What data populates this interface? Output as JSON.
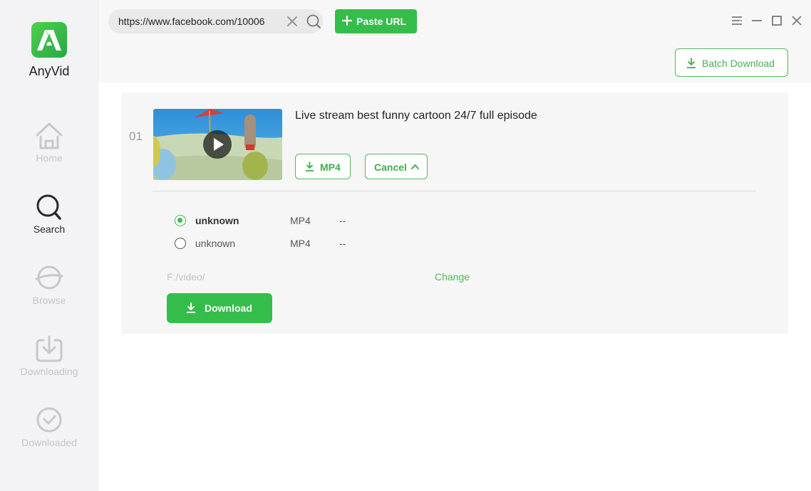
{
  "app": {
    "name": "AnyVid",
    "accent_color": "#35bd4b"
  },
  "sidebar": {
    "items": [
      {
        "label": "Home",
        "icon": "home-icon",
        "active": false
      },
      {
        "label": "Search",
        "icon": "search-icon",
        "active": true
      },
      {
        "label": "Browse",
        "icon": "planet-icon",
        "active": false
      },
      {
        "label": "Downloading",
        "icon": "download-tray-icon",
        "active": false
      },
      {
        "label": "Downloaded",
        "icon": "check-circle-icon",
        "active": false
      }
    ]
  },
  "topbar": {
    "url_value": "https://www.facebook.com/10006",
    "paste_label": "Paste URL",
    "window_controls": [
      "menu-icon",
      "minimize-icon",
      "maximize-icon",
      "close-icon"
    ]
  },
  "subbar": {
    "batch_label": "Batch Download"
  },
  "result": {
    "index": "01",
    "title": "Live stream best funny cartoon 24/7 full episode",
    "format_button": "MP4",
    "cancel_button": "Cancel",
    "options": [
      {
        "quality": "unknown",
        "format": "MP4",
        "size": "--",
        "selected": true
      },
      {
        "quality": "unknown",
        "format": "MP4",
        "size": "--",
        "selected": false
      }
    ],
    "save_path": "F:/video/",
    "change_label": "Change",
    "download_label": "Download"
  }
}
